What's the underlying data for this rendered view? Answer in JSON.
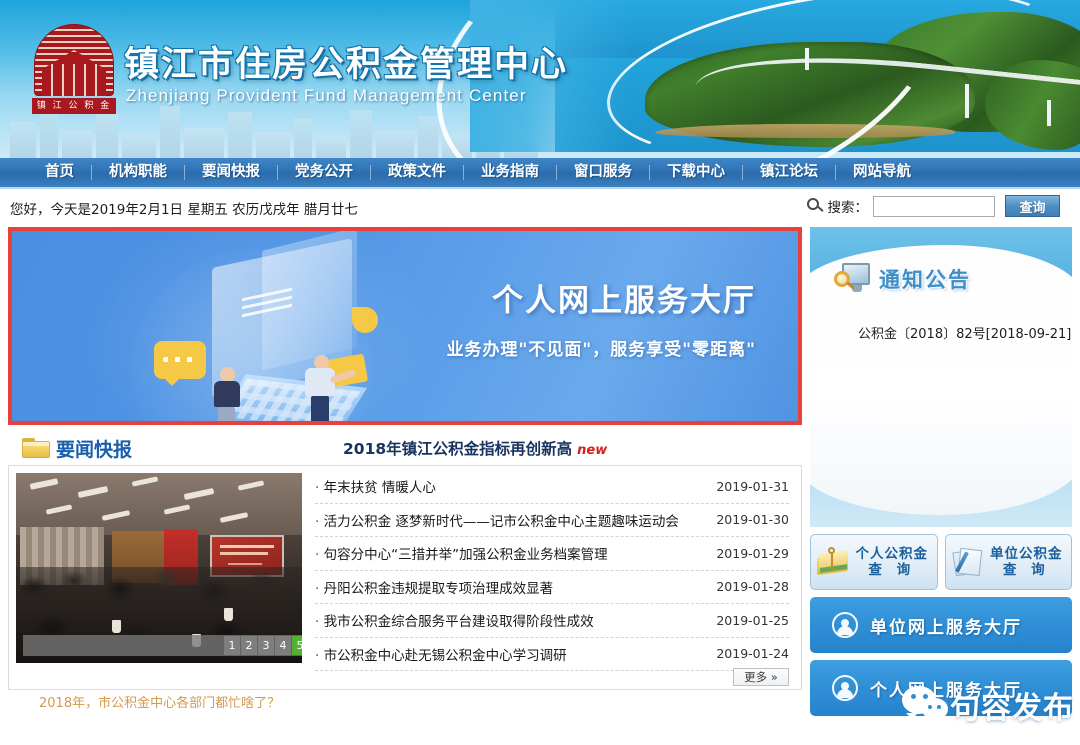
{
  "site": {
    "title_zh": "镇江市住房公积金管理中心",
    "title_en": "Zhenjiang Provident Fund Management Center",
    "logo_text": "镇 江 公 积 金",
    "brand_color": "#1a5fad",
    "accent_red": "#e8413c",
    "nav_bg": "#2e72b4"
  },
  "nav": {
    "items": [
      {
        "label": "首页"
      },
      {
        "label": "机构职能"
      },
      {
        "label": "要闻快报"
      },
      {
        "label": "党务公开"
      },
      {
        "label": "政策文件"
      },
      {
        "label": "业务指南"
      },
      {
        "label": "窗口服务"
      },
      {
        "label": "下载中心"
      },
      {
        "label": "镇江论坛"
      },
      {
        "label": "网站导航"
      }
    ]
  },
  "greeting": {
    "text": "您好，今天是2019年2月1日 星期五 农历戊戌年 腊月廿七"
  },
  "search": {
    "icon": "search-icon",
    "label": "搜索：",
    "value": "",
    "placeholder": "",
    "button_label": "查询"
  },
  "promo": {
    "title": "个人网上服务大厅",
    "subtitle": "业务办理\"不见面\"，服务享受\"零距离\"",
    "border_color": "#e8413c"
  },
  "news": {
    "section_icon": "folder-icon",
    "section_title": "要闻快报",
    "headline": "2018年镇江公积金指标再创新高",
    "headline_badge": "new",
    "photo_caption": "2018年，市公积金中心各部门都忙啥了？",
    "pager": [
      "1",
      "2",
      "3",
      "4",
      "5"
    ],
    "pager_active": "5",
    "more_label": "更多 »",
    "items": [
      {
        "title": "年末扶贫 情暖人心",
        "date": "2019-01-31"
      },
      {
        "title": "活力公积金 逐梦新时代——记市公积金中心主题趣味运动会",
        "date": "2019-01-30"
      },
      {
        "title": "句容分中心“三措并举”加强公积金业务档案管理",
        "date": "2019-01-29"
      },
      {
        "title": "丹阳公积金违规提取专项治理成效显著",
        "date": "2019-01-28"
      },
      {
        "title": "我市公积金综合服务平台建设取得阶段性成效",
        "date": "2019-01-25"
      },
      {
        "title": "市公积金中心赴无锡公积金中心学习调研",
        "date": "2019-01-24"
      }
    ]
  },
  "sidebar": {
    "notice": {
      "icon": "monitor-search-icon",
      "title": "通知公告",
      "items": [
        {
          "text": "公积金〔2018〕82号[2018-09-21]"
        }
      ]
    },
    "query_buttons": [
      {
        "icon": "passbook-key-icon",
        "line1": "个人公积金",
        "line2": "查 询"
      },
      {
        "icon": "document-pen-icon",
        "line1": "单位公积金",
        "line2": "查 询"
      }
    ],
    "hall_buttons": [
      {
        "icon": "user-icon",
        "label": "单位网上服务大厅"
      },
      {
        "icon": "user-icon",
        "label": "个人网上服务大厅"
      }
    ]
  },
  "watermark": {
    "icon": "wechat-icon",
    "text": "句容发布"
  }
}
